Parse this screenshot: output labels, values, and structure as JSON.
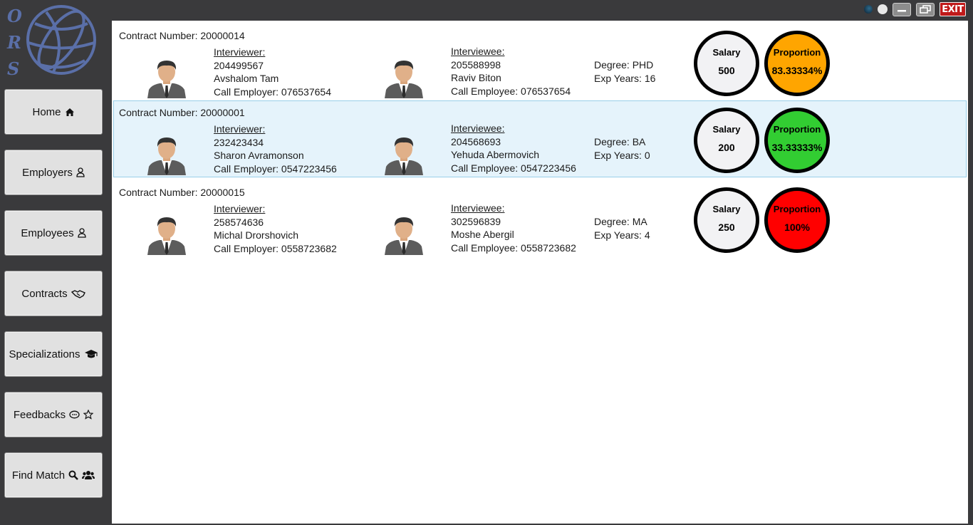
{
  "logo": {
    "letters": [
      "O",
      "R",
      "S"
    ]
  },
  "nav": [
    {
      "label": "Home",
      "icon": "home-icon"
    },
    {
      "label": "Employers",
      "icon": "user-icon"
    },
    {
      "label": "Employees",
      "icon": "user-icon"
    },
    {
      "label": "Contracts",
      "icon": "handshake-icon"
    },
    {
      "label": "Specializations",
      "icon": "graduation-cap-icon"
    },
    {
      "label": "Feedbacks",
      "icon": "comment-star-icon"
    },
    {
      "label": "Find Match",
      "icon": "search-users-icon"
    }
  ],
  "window": {
    "exit_label": "EXIT"
  },
  "contracts": [
    {
      "contract_number": "Contract Number: 20000014",
      "interviewer": {
        "header": "Interviewer:",
        "id": "204499567",
        "name": "Avshalom Tam",
        "call": "Call Employer: 076537654"
      },
      "interviewee": {
        "header": "Interviewee:",
        "id": "205588998",
        "name": "Raviv Biton",
        "call": "Call Employee: 076537654"
      },
      "degree": "Degree: PHD",
      "exp": "Exp Years: 16",
      "salary_label": "Salary",
      "salary": "500",
      "proportion_label": "Proportion",
      "proportion": "83.33334%",
      "proportion_color": "#ffa500",
      "selected": false
    },
    {
      "contract_number": "Contract Number: 20000001",
      "interviewer": {
        "header": "Interviewer:",
        "id": "232423434",
        "name": "Sharon Avramonson",
        "call": "Call Employer: 0547223456"
      },
      "interviewee": {
        "header": "Interviewee:",
        "id": "204568693",
        "name": "Yehuda Abermovich",
        "call": "Call Employee: 0547223456"
      },
      "degree": "Degree: BA",
      "exp": "Exp Years: 0",
      "salary_label": "Salary",
      "salary": "200",
      "proportion_label": "Proportion",
      "proportion": "33.33333%",
      "proportion_color": "#32cd32",
      "selected": true
    },
    {
      "contract_number": "Contract Number: 20000015",
      "interviewer": {
        "header": "Interviewer:",
        "id": "258574636",
        "name": "Michal Drorshovich",
        "call": "Call Employer: 0558723682"
      },
      "interviewee": {
        "header": "Interviewee:",
        "id": "302596839",
        "name": "Moshe Abergil",
        "call": "Call Employee: 0558723682"
      },
      "degree": "Degree: MA",
      "exp": "Exp Years: 4",
      "salary_label": "Salary",
      "salary": "250",
      "proportion_label": "Proportion",
      "proportion": "100%",
      "proportion_color": "#ff0000",
      "selected": false
    }
  ]
}
